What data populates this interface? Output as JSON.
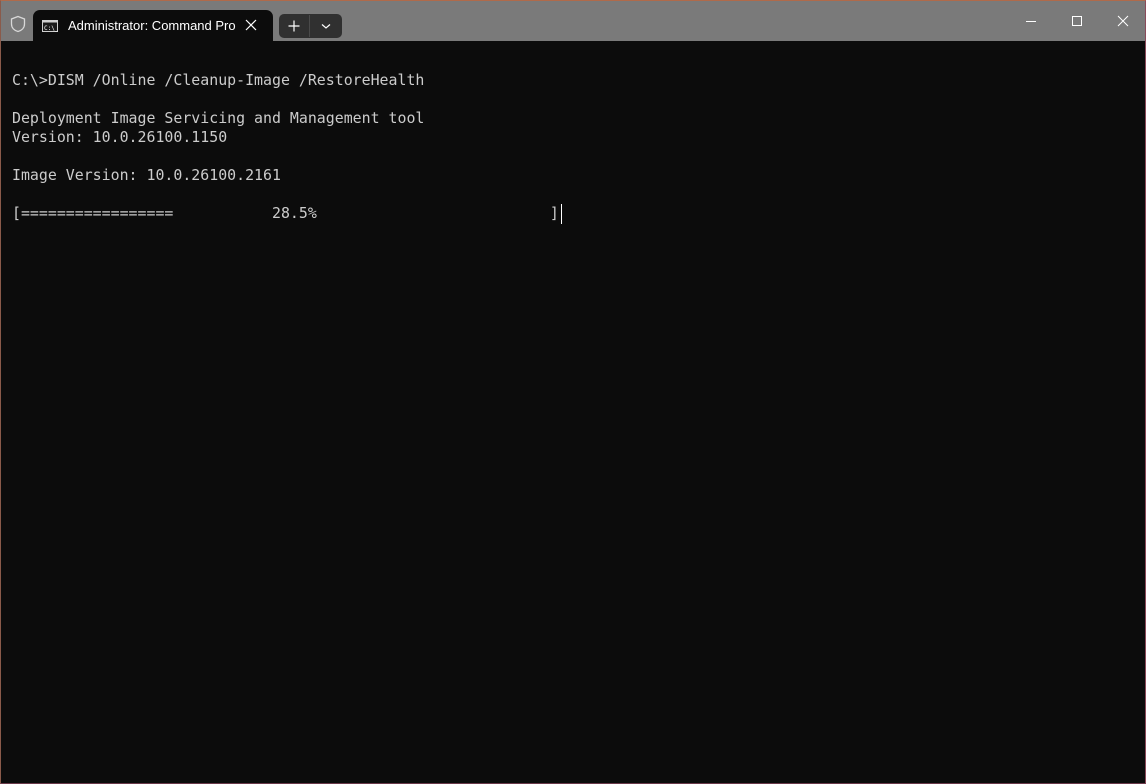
{
  "window": {
    "tab_title": "Administrator: Command Pro",
    "icons": {
      "shield": "shield-icon",
      "tab": "command-prompt-icon",
      "close_tab": "close-icon",
      "new_tab": "plus-icon",
      "dropdown": "chevron-down-icon",
      "minimize": "minimize-icon",
      "maximize": "maximize-icon",
      "close": "close-icon"
    },
    "colors": {
      "titlebar": "#7a7a7a",
      "terminal_bg": "#0c0c0c",
      "text": "#cccccc"
    }
  },
  "terminal": {
    "lines": [
      "C:\\>DISM /Online /Cleanup-Image /RestoreHealth",
      "Deployment Image Servicing and Management tool",
      "Version: 10.0.26100.1150",
      "Image Version: 10.0.26100.2161",
      "[=================           28.5%                          ]"
    ],
    "progress_percent": 28.5
  }
}
